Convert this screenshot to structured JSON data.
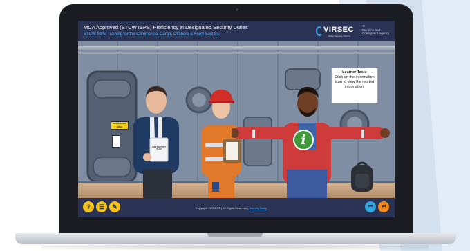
{
  "course": {
    "title": "MCA Approved (STCW ISPS) Proficiency in Designated Security Duties",
    "subtitle": "STCW ISPS Training for the Commercial Cargo, Offshore & Ferry Sectors"
  },
  "branding": {
    "logo": "VIRSEC",
    "logo_tagline": "Safety-Security Training",
    "agency_line1": "Maritime and",
    "agency_line2": "Coastguard Agency"
  },
  "scene": {
    "restricted_sign": "RESTRICTED AREA",
    "clipboard_label": "SHIP SECURITY PLAN"
  },
  "task": {
    "title": "Learner Task:",
    "body": "Click on the information icon to view the related information."
  },
  "info_icon": {
    "glyph": "i",
    "color": "#3f9b3a"
  },
  "footer": {
    "help_icon": "question-icon",
    "menu_icon": "menu-list-icon",
    "notes_icon": "pencil-icon",
    "copyright": "Copyright VIRSEC® | All Rights Reserved |",
    "link": "Security Notify",
    "prev_icon": "previous-icon",
    "next_icon": "next-icon"
  },
  "colors": {
    "header": "#2b3354",
    "accent_yellow": "#f4c21b",
    "accent_blue": "#2ea7e0",
    "accent_orange": "#f28a1c"
  }
}
